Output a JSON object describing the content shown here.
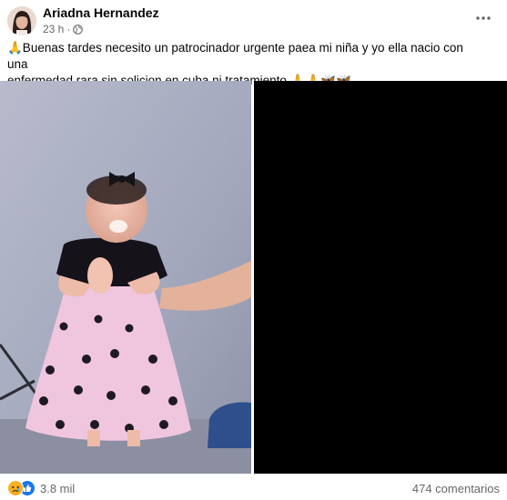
{
  "post": {
    "author": "Ariadna Hernandez",
    "time": "23 h",
    "separator": "·",
    "text_line1": "🙏Buenas tardes necesito un patrocinador urgente paea mi niña y yo ella nacio con una",
    "text_line2": "enfermedad rara sin solicion en cuba ni tratamiento 🙏🙏🦋🦋"
  },
  "icons": {
    "audience": "globe-icon",
    "menu": "more-options-icon",
    "reaction_1": "sad-reaction-icon",
    "reaction_2": "like-reaction-icon"
  },
  "footer": {
    "reaction_count": "3.8 mil",
    "comment_count": "474 comentarios"
  },
  "colors": {
    "secondary_text": "#65676b",
    "like_blue": "#1877f2",
    "sad_yellow": "#f7b125"
  }
}
